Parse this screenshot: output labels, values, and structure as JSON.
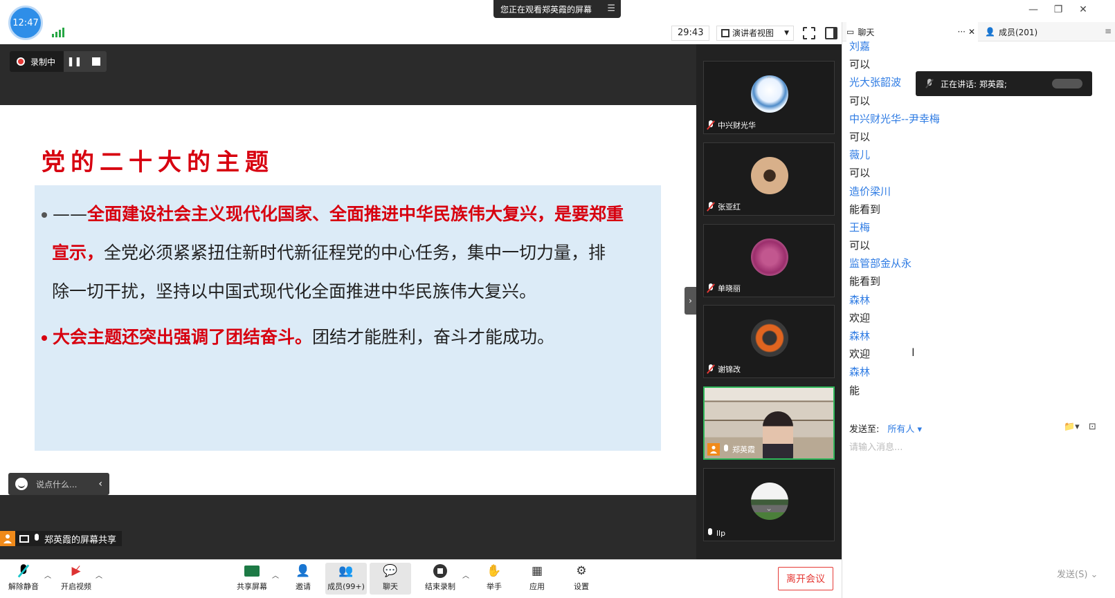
{
  "titlebar": {
    "clock": "12:47",
    "viewing_banner": "您正在观看郑英霞的屏幕"
  },
  "toolbar": {
    "timer": "29:43",
    "view_mode": "演讲者视图"
  },
  "recording": {
    "label": "录制中"
  },
  "slide": {
    "title": "党的二十大的主题",
    "line1_prefix": "——",
    "line1_red": "全面建设社会主义现代化国家、全面推进中华民族伟大复兴，是要郑重",
    "line2_red": "宣示，",
    "line2_text": "全党必须紧紧扭住新时代新征程党的中心任务，集中一切力量，排",
    "line3_text": "除一切干扰，坚持以中国式现代化全面推进中华民族伟大复兴。",
    "line4_red": "大会主题还突出强调了团结奋斗。",
    "line4_text": "团结才能胜利，奋斗才能成功。"
  },
  "comment_box": {
    "placeholder": "说点什么..."
  },
  "share_label": "郑英霞的屏幕共享",
  "video_tiles": [
    {
      "name": "中兴财光华",
      "muted": true
    },
    {
      "name": "张亚红",
      "muted": true
    },
    {
      "name": "单晓丽",
      "muted": true
    },
    {
      "name": "谢锦改",
      "muted": true
    },
    {
      "name": "郑英霞",
      "muted": false,
      "active": true
    },
    {
      "name": "llp",
      "muted": false
    }
  ],
  "bottom_bar": {
    "unmute": "解除静音",
    "start_video": "开启视频",
    "share_screen": "共享屏幕",
    "invite": "邀请",
    "members": "成员(99+)",
    "chat": "聊天",
    "end_record": "结束录制",
    "raise_hand": "举手",
    "apps": "应用",
    "settings": "设置",
    "leave": "离开会议"
  },
  "chat_panel": {
    "tab_chat": "聊天",
    "tab_members": "成员(201)",
    "speaking_now": "正在讲话: 郑英霞;",
    "messages": [
      {
        "sender": "刘嘉",
        "text": "可以"
      },
      {
        "sender": "光大张韶波",
        "text": "可以"
      },
      {
        "sender": "中兴财光华--尹幸梅",
        "text": "可以"
      },
      {
        "sender": "薇儿",
        "text": "可以"
      },
      {
        "sender": "造价梁川",
        "text": "能看到"
      },
      {
        "sender": "王梅",
        "text": "可以"
      },
      {
        "sender": "监管部金从永",
        "text": "能看到"
      },
      {
        "sender": "森林",
        "text": "欢迎"
      },
      {
        "sender": "森林",
        "text": "欢迎"
      },
      {
        "sender": "森林",
        "text": "能"
      }
    ],
    "send_to_label": "发送至:",
    "send_to_target": "所有人",
    "input_placeholder": "请输入消息...",
    "send_button": "发送(S)"
  },
  "colors": {
    "accent_blue": "#2e7be3",
    "slide_red": "#d7000f",
    "leave_red": "#e53935",
    "active_green": "#2fb85a"
  }
}
